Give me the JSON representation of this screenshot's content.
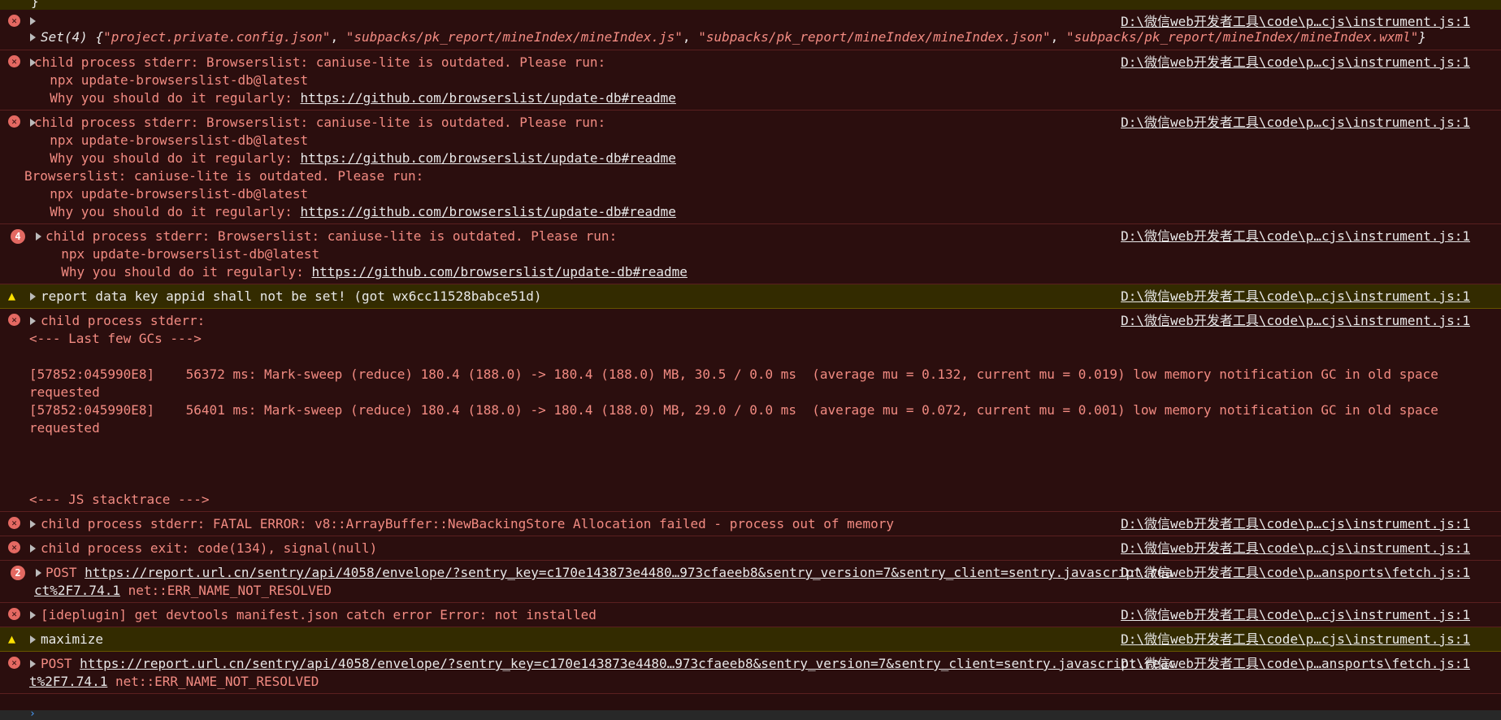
{
  "top_fragment": "}",
  "set_row": {
    "source": "D:\\微信web开发者工具\\code\\p…cjs\\instrument.js:1",
    "label": "Set(4)",
    "open_brace": "{",
    "items": [
      "\"project.private.config.json\"",
      "\"subpacks/pk_report/mineIndex/mineIndex.js\"",
      "\"subpacks/pk_report/mineIndex/mineIndex.json\"",
      "\"subpacks/pk_report/mineIndex/mineIndex.wxml\""
    ],
    "close_brace": "}"
  },
  "browserslist1": {
    "line1": "child process stderr: Browserslist: caniuse-lite is outdated. Please run:",
    "line2": "  npx update-browserslist-db@latest",
    "line3_prefix": "  Why you should do it regularly: ",
    "link": "https://github.com/browserslist/update-db#readme",
    "source": "D:\\微信web开发者工具\\code\\p…cjs\\instrument.js:1"
  },
  "browserslist2": {
    "line1": "child process stderr: Browserslist: caniuse-lite is outdated. Please run:",
    "line2": "  npx update-browserslist-db@latest",
    "line3_prefix": "  Why you should do it regularly: ",
    "link": "https://github.com/browserslist/update-db#readme",
    "line4": "Browserslist: caniuse-lite is outdated. Please run:",
    "line5": "  npx update-browserslist-db@latest",
    "line6_prefix": "  Why you should do it regularly: ",
    "link2": "https://github.com/browserslist/update-db#readme",
    "source": "D:\\微信web开发者工具\\code\\p…cjs\\instrument.js:1"
  },
  "browserslist3": {
    "badge": "4",
    "line1": "child process stderr: Browserslist: caniuse-lite is outdated. Please run:",
    "line2": "  npx update-browserslist-db@latest",
    "line3_prefix": "  Why you should do it regularly: ",
    "link": "https://github.com/browserslist/update-db#readme",
    "source": "D:\\微信web开发者工具\\code\\p…cjs\\instrument.js:1"
  },
  "warning_appid": {
    "text": "report data key appid shall not be set! (got wx6cc11528babce51d)",
    "source": "D:\\微信web开发者工具\\code\\p…cjs\\instrument.js:1"
  },
  "gc_entry": {
    "header": "child process stderr:",
    "line1": "<--- Last few GCs --->",
    "line2": "[57852:045990E8]    56372 ms: Mark-sweep (reduce) 180.4 (188.0) -> 180.4 (188.0) MB, 30.5 / 0.0 ms  (average mu = 0.132, current mu = 0.019) low memory notification GC in old space requested",
    "line3": "[57852:045990E8]    56401 ms: Mark-sweep (reduce) 180.4 (188.0) -> 180.4 (188.0) MB, 29.0 / 0.0 ms  (average mu = 0.072, current mu = 0.001) low memory notification GC in old space requested",
    "line4": "<--- JS stacktrace --->",
    "source": "D:\\微信web开发者工具\\code\\p…cjs\\instrument.js:1"
  },
  "fatal": {
    "text": "child process stderr: FATAL ERROR: v8::ArrayBuffer::NewBackingStore Allocation failed - process out of memory",
    "source": "D:\\微信web开发者工具\\code\\p…cjs\\instrument.js:1"
  },
  "exit": {
    "text": "child process exit: code(134), signal(null)",
    "source": "D:\\微信web开发者工具\\code\\p…cjs\\instrument.js:1"
  },
  "post1": {
    "badge": "2",
    "method": "POST ",
    "url": "https://report.url.cn/sentry/api/4058/envelope/?sentry_key=c170e143873e4480…973cfaeeb8&sentry_version=7&sentry_client=sentry.javascript.react%2F7.74.1",
    "status": " net::ERR_NAME_NOT_RESOLVED",
    "source": "D:\\微信web开发者工具\\code\\p…ansports\\fetch.js:1"
  },
  "ideplugin": {
    "text": "[ideplugin] get devtools manifest.json catch error Error: not installed",
    "source": "D:\\微信web开发者工具\\code\\p…cjs\\instrument.js:1"
  },
  "warning_maximize": {
    "text": "maximize",
    "source": "D:\\微信web开发者工具\\code\\p…cjs\\instrument.js:1"
  },
  "post2": {
    "method": "POST ",
    "url": "https://report.url.cn/sentry/api/4058/envelope/?sentry_key=c170e143873e4480…973cfaeeb8&sentry_version=7&sentry_client=sentry.javascript.react%2F7.74.1",
    "status": " net::ERR_NAME_NOT_RESOLVED",
    "source": "D:\\微信web开发者工具\\code\\p…ansports\\fetch.js:1"
  },
  "prompt_glyph": "›",
  "colors": {
    "error_bg": "#2b0e0e",
    "error_text": "#f28b82",
    "warning_bg": "#332b00",
    "warning_text": "#fce100"
  }
}
